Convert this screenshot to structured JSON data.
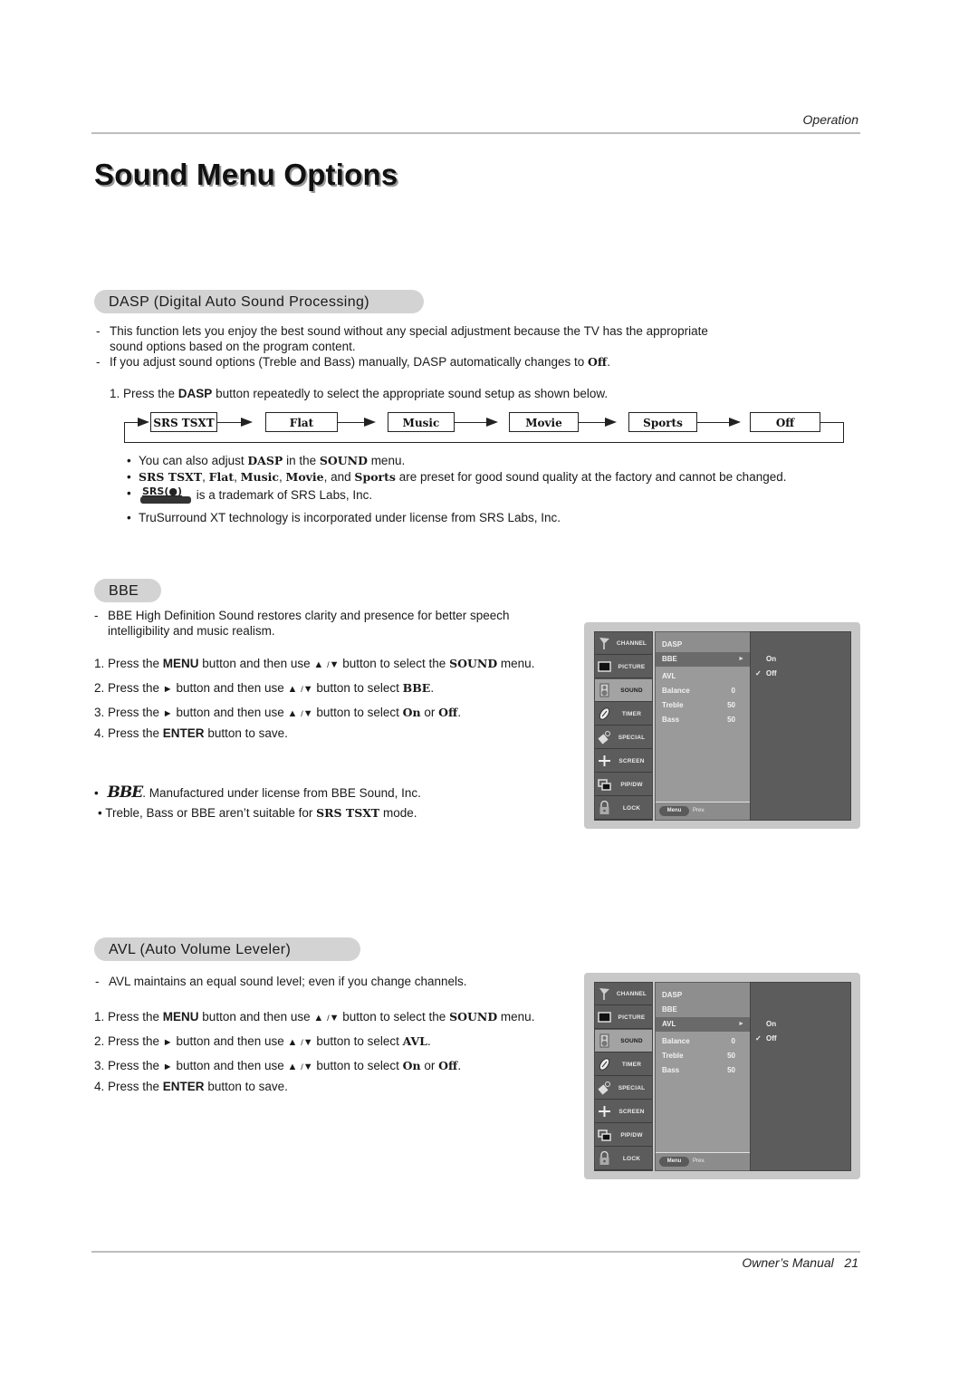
{
  "header": {
    "section": "Operation"
  },
  "page_title": "Sound Menu Options",
  "dasp": {
    "heading": "DASP (Digital Auto Sound Processing)",
    "notes": [
      [
        "This function lets you enjoy the best sound without any special adjustment because the TV has the appropriate",
        "sound options based on the program content."
      ],
      [
        "If you adjust sound options (Treble and Bass) manually, DASP automatically changes to ",
        "Off",
        "."
      ]
    ],
    "step1": {
      "pre": "1. Press the ",
      "key": "DASP",
      "post": " button repeatedly to select the appropriate sound setup as shown below."
    },
    "flow": [
      "SRS TSXT",
      "Flat",
      "Music",
      "Movie",
      "Sports",
      "Off"
    ],
    "bullets": {
      "b1": {
        "pre": "You can also adjust ",
        "k1": "DASP",
        "mid": " in the ",
        "k2": "SOUND",
        "post": " menu."
      },
      "b2": {
        "k1": "SRS TSXT",
        "s1": ", ",
        "k2": "Flat",
        "s2": ", ",
        "k3": "Music",
        "s3": ", ",
        "k4": "Movie",
        "s4": ", and ",
        "k5": "Sports",
        "post": " are preset for good sound quality at the factory and cannot be changed."
      },
      "b3": {
        "logo": "SRS(●)",
        "post": " is a trademark of SRS Labs, Inc."
      },
      "b4": "TruSurround XT technology is incorporated under license from SRS Labs, Inc."
    }
  },
  "bbe": {
    "heading": "BBE",
    "note": [
      "BBE High Definition Sound restores clarity and presence for better speech",
      "intelligibility and music realism."
    ],
    "steps": [
      {
        "n": "1. ",
        "pre": "Press the ",
        "k1": "MENU",
        "mid": " button and then use ",
        "post": " button to select the ",
        "k2": "SOUND",
        "end": " menu."
      },
      {
        "n": "2. ",
        "pre": "Press the ",
        "mid": " button and then use ",
        "post": " button to select ",
        "k2": "BBE",
        "end": "."
      },
      {
        "n": "3. ",
        "pre": "Press the ",
        "mid": " button and then use ",
        "post": " button to select ",
        "k2": "On",
        "or": " or ",
        "k3": "Off",
        "end": "."
      },
      {
        "n": "4. ",
        "pre": "Press the ",
        "k1": "ENTER",
        "post": " button to save."
      }
    ],
    "bullet1": {
      "logo": "BBE",
      "post": ". Manufactured under license from BBE Sound, Inc."
    },
    "bullet2": {
      "pre": "Treble, Bass or BBE aren’t suitable for ",
      "k": "SRS TSXT",
      "post": " mode."
    }
  },
  "avl": {
    "heading": "AVL (Auto Volume Leveler)",
    "note": "AVL maintains an equal sound level; even if you change channels.",
    "steps": [
      {
        "n": "1. ",
        "pre": "Press the ",
        "k1": "MENU",
        "mid": " button and then use ",
        "post": " button to select the ",
        "k2": "SOUND",
        "end": " menu."
      },
      {
        "n": "2. ",
        "pre": "Press the ",
        "mid": " button and then use ",
        "post": " button to select ",
        "k2": "AVL",
        "end": "."
      },
      {
        "n": "3. ",
        "pre": "Press the ",
        "mid": " button and then use ",
        "post": " button to select ",
        "k2": "On",
        "or": " or ",
        "k3": "Off",
        "end": "."
      },
      {
        "n": "4. ",
        "pre": "Press the ",
        "k1": "ENTER",
        "post": " button to save."
      }
    ]
  },
  "symbols": {
    "up": "▲",
    "slash": "/",
    "down": "▼",
    "right": "►",
    "bullet": "•",
    "dash": "-",
    "check": "✓"
  },
  "osd": {
    "menu_items": [
      "CHANNEL",
      "PICTURE",
      "SOUND",
      "TIMER",
      "SPECIAL",
      "SCREEN",
      "PIP/DW",
      "LOCK"
    ],
    "active_menu": "SOUND",
    "sound_items": [
      {
        "label": "DASP",
        "value": ""
      },
      {
        "label": "BBE",
        "value": ""
      },
      {
        "label": "AVL",
        "value": ""
      },
      {
        "label": "Balance",
        "value": "0"
      },
      {
        "label": "Treble",
        "value": "50"
      },
      {
        "label": "Bass",
        "value": "50"
      }
    ],
    "options": [
      "On",
      "Off"
    ],
    "checked_option": "Off",
    "footer": {
      "button": "Menu",
      "label": "Prev."
    },
    "panel1_selected": "BBE",
    "panel2_selected": "AVL"
  },
  "footer": {
    "title": "Owner’s Manual",
    "page": "21"
  }
}
